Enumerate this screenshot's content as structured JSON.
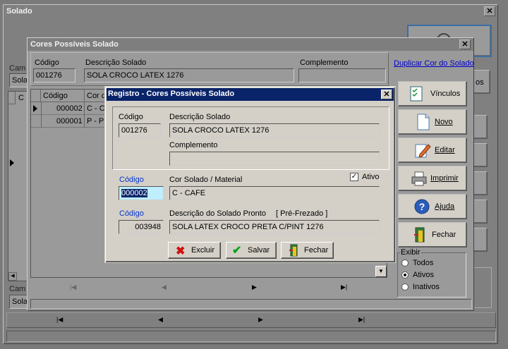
{
  "main": {
    "title": "Solado",
    "cam_label_1": "Cam",
    "cam_value_1": "Sola",
    "cam_label_2": "Cam",
    "cam_value_2": "Sola",
    "grid_col": "C",
    "tb_right_label": "os",
    "nav": [
      "|◀",
      "◀",
      "▶",
      "▶|"
    ]
  },
  "cores": {
    "title": "Cores Possíveis Solado",
    "codigo_label": "Código",
    "codigo_value": "001276",
    "descricao_label": "Descrição Solado",
    "descricao_value": "SOLA CROCO LATEX 1276",
    "complemento_label": "Complemento",
    "complemento_value": "",
    "duplicar_link": "Duplicar Cor do Solado",
    "grid_headers": [
      "Código",
      "Cor do"
    ],
    "grid_rows": [
      {
        "codigo": "000002",
        "cor": "C - CA"
      },
      {
        "codigo": "000001",
        "cor": "P - PR"
      }
    ],
    "buttons": {
      "vinculos": "Vínculos",
      "novo": "Novo",
      "editar": "Editar",
      "imprimir": "Imprimir",
      "ajuda": "Ajuda",
      "fechar": "Fechar"
    },
    "exibir": {
      "title": "Exibir",
      "options": [
        "Todos",
        "Ativos",
        "Inativos"
      ],
      "selected": "Ativos"
    },
    "nav": [
      "|◀",
      "◀",
      "▶",
      "▶|"
    ]
  },
  "registro": {
    "title": "Registro - Cores Possíveis Solado",
    "codigo_label": "Código",
    "codigo_value": "001276",
    "descricao_label": "Descrição Solado",
    "descricao_value": "SOLA CROCO LATEX 1276",
    "complemento_label": "Complemento",
    "complemento_value": "",
    "codigo2_label": "Código",
    "codigo2_value": "000002",
    "cor_label": "Cor Solado / Material",
    "cor_value": "C - CAFE",
    "ativo_label": "Ativo",
    "ativo_checked": true,
    "codigo3_label": "Código",
    "codigo3_value": "003948",
    "pronto_label": "Descrição do Solado Pronto",
    "prefrezado_label": "[ Pré-Frezado ]",
    "pronto_value": "SOLA LATEX CROCO PRETA C/PINT 1276",
    "excluir": "Excluir",
    "salvar": "Salvar",
    "fechar": "Fechar"
  },
  "colors": {
    "active_title": "#0a246a",
    "link_blue": "#0000cc",
    "label_blue": "#0033cc",
    "highlight_field": "#bfefff"
  }
}
